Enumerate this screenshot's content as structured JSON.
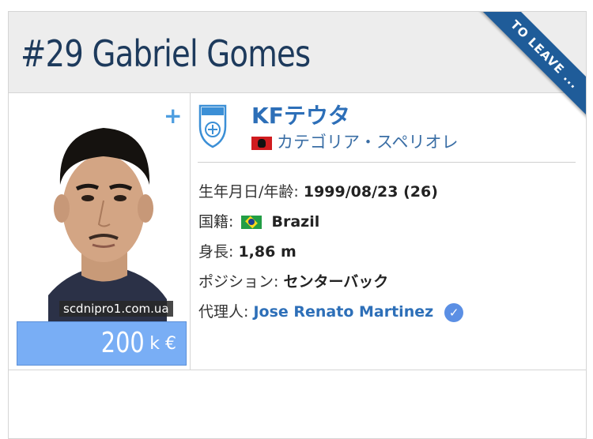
{
  "header": {
    "title": "#29 Gabriel Gomes",
    "ribbon": "TO LEAVE ..."
  },
  "player": {
    "plus": "+",
    "photo_watermark": "scdnipro1.com.ua",
    "market_value": "200",
    "market_value_unit": "k €"
  },
  "club": {
    "name": "KFテウタ",
    "league": "カテゴリア・スペリオレ",
    "league_flag": "albania-flag-icon"
  },
  "details": {
    "birth_label": "生年月日/年齢:",
    "birth_value": "1999/08/23 (26)",
    "nationality_label": "国籍:",
    "nationality_value": "Brazil",
    "height_label": "身長:",
    "height_value": "1,86 m",
    "position_label": "ポジション:",
    "position_value": "センターバック",
    "agent_label": "代理人:",
    "agent_value": "Jose Renato Martinez"
  },
  "colors": {
    "title": "#1d3a5c",
    "ribbon": "#1f5c99",
    "link": "#2d6fb8",
    "value_box": "#79aef5"
  }
}
